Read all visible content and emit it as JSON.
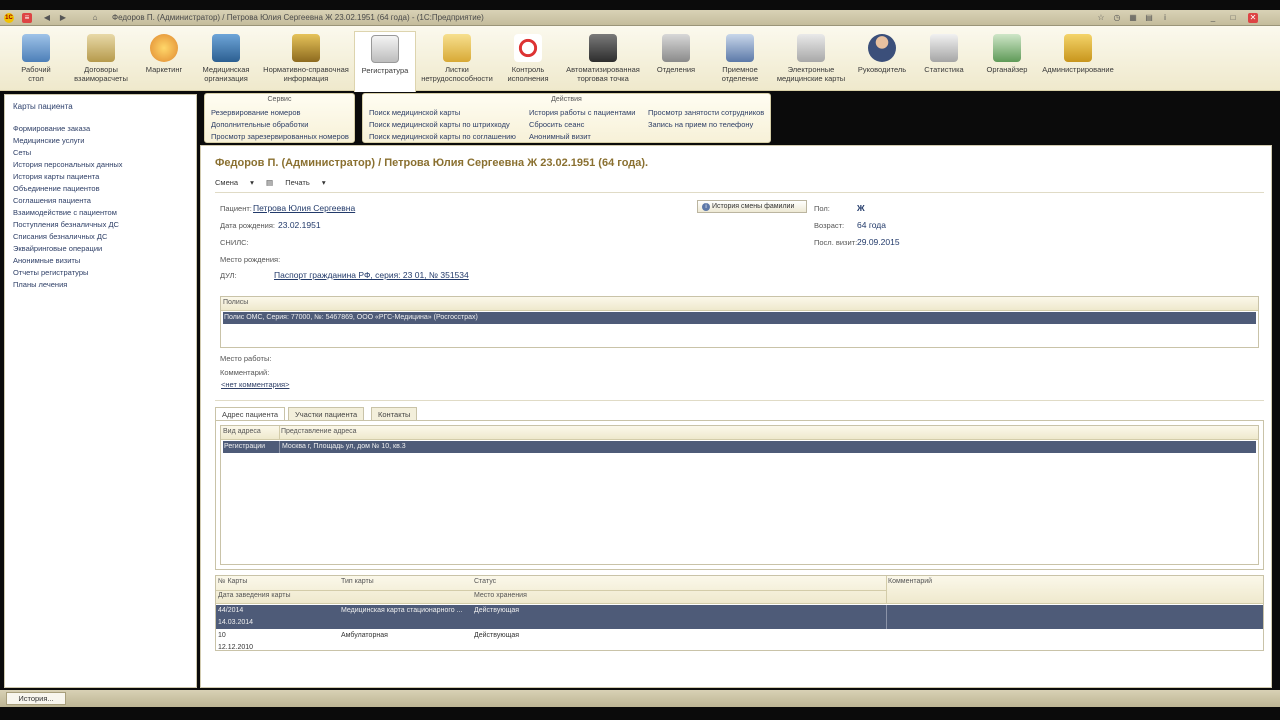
{
  "window": {
    "title": "Федоров П. (Администратор) / Петрова Юлия Сергеевна Ж 23.02.1951 (64 года) - (1С:Предприятие)"
  },
  "toolbar": {
    "sections": [
      {
        "label": "Рабочий\nстол",
        "icon": "desktop-icon"
      },
      {
        "label": "Договоры\nвзаиморасчеты",
        "icon": "contracts-icon"
      },
      {
        "label": "Маркетинг",
        "icon": "marketing-icon"
      },
      {
        "label": "Медицинская\nорганизация",
        "icon": "organization-icon"
      },
      {
        "label": "Нормативно-справочная\nинформация",
        "icon": "reference-books-icon"
      },
      {
        "label": "Регистратура",
        "icon": "registry-icon"
      },
      {
        "label": "Листки\nнетрудоспособности",
        "icon": "sick-leave-icon"
      },
      {
        "label": "Контроль\nисполнения",
        "icon": "control-icon"
      },
      {
        "label": "Автоматизированная\nторговая точка",
        "icon": "cash-register-icon"
      },
      {
        "label": "Отделения",
        "icon": "departments-icon"
      },
      {
        "label": "Приемное\nотделение",
        "icon": "reception-icon"
      },
      {
        "label": "Электронные\nмедицинские карты",
        "icon": "emr-icon"
      },
      {
        "label": "Руководитель",
        "icon": "manager-icon"
      },
      {
        "label": "Статистика",
        "icon": "statistics-icon"
      },
      {
        "label": "Органайзер",
        "icon": "organizer-icon"
      },
      {
        "label": "Администрирование",
        "icon": "administration-icon"
      }
    ],
    "active": "Регистратура"
  },
  "sidebar": {
    "header": "Карты пациента",
    "items": [
      "Формирование заказа",
      "Медицинские услуги",
      "Сеты",
      "История персональных данных",
      "История карты пациента",
      "Объединение пациентов",
      "Соглашения пациента",
      "Взаимодействие с пациентом",
      "Поступления безналичных ДС",
      "Списания безналичных ДС",
      "Эквайринговые операции",
      "Анонимные визиты",
      "Отчеты регистратуры",
      "Планы лечения"
    ]
  },
  "service_panel": {
    "title": "Сервис",
    "items": [
      "Резервирование номеров",
      "Дополнительные обработки",
      "Просмотр зарезервированных номеров"
    ]
  },
  "actions_panel": {
    "title": "Действия",
    "col1": [
      "Поиск медицинской карты",
      "Поиск медицинской карты по штрихкоду",
      "Поиск медицинской карты по соглашению"
    ],
    "col2": [
      "История работы с пациентами",
      "Сбросить сеанс",
      "Анонимный визит"
    ],
    "col3": [
      "Просмотр занятости сотрудников",
      "Запись на прием по телефону"
    ]
  },
  "document": {
    "title": "Федоров П. (Администратор) / Петрова Юлия Сергеевна Ж 23.02.1951 (64 года).",
    "toolbar": {
      "change": "Смена",
      "print": "Печать"
    },
    "patient_label": "Пациент:",
    "patient_value": "Петрова Юлия Сергеевна",
    "name_history_button": "История смены фамилии",
    "gender_label": "Пол:",
    "gender_value": "Ж",
    "birth_label": "Дата рождения:",
    "birth_value": "23.02.1951",
    "age_label": "Возраст:",
    "age_value": "64 года",
    "last_visit_label": "Посл. визит:",
    "last_visit_value": "29.09.2015",
    "snils_label": "СНИЛС:",
    "birthplace_label": "Место рождения:",
    "dul_label": "ДУЛ:",
    "dul_value": "Паспорт гражданина РФ, серия: 23 01, № 351534",
    "policies": {
      "header": "Полисы",
      "rows": [
        "Полис ОМС, Серия: 77000, №: 5467869, ООО «РГС-Медицина» (Росгосстрах)"
      ]
    },
    "workplace_label": "Место работы:",
    "comment_label": "Комментарий:",
    "comment_link": "<нет комментария>",
    "tabs": [
      "Адрес пациента",
      "Участки пациента",
      "Контакты"
    ],
    "active_tab": "Адрес пациента",
    "address_grid": {
      "headers": [
        "Вид адреса",
        "Представление адреса"
      ],
      "rows": [
        [
          "Регистрации",
          "Москва г, Площадь ул, дом № 10, кв.3"
        ]
      ]
    },
    "cards_grid": {
      "headers": [
        "№ Карты",
        "Тип карты",
        "Статус",
        "Комментарий"
      ],
      "subheaders": [
        "Дата заведения карты",
        "Место хранения"
      ],
      "rows": [
        {
          "number": "44/2014",
          "type": "Медицинская карта стационарного ...",
          "status": "Действующая",
          "date": "14.03.2014"
        },
        {
          "number": "10",
          "type": "Амбулаторная",
          "status": "Действующая",
          "date": "12.12.2010"
        }
      ]
    }
  },
  "statusbar": {
    "history_button": "История..."
  },
  "colors": {
    "toolbar_bg": "#f4efd6",
    "link": "#2d3e66",
    "title_accent": "#8a7030",
    "selection": "#4e5b78"
  }
}
